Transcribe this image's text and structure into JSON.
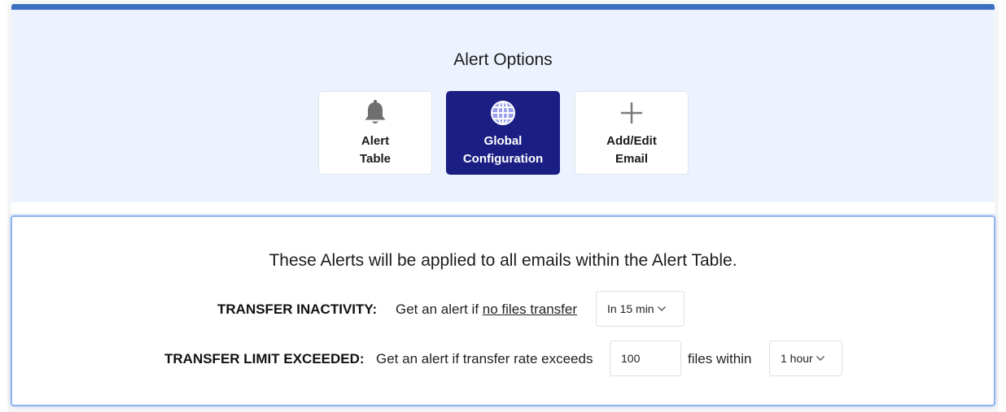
{
  "header": {
    "title": "Alert Options",
    "options": [
      {
        "line1": "Alert",
        "line2": "Table",
        "icon": "bell-icon",
        "active": false
      },
      {
        "line1": "Global",
        "line2": "Configuration",
        "icon": "globe-icon",
        "active": true
      },
      {
        "line1": "Add/Edit",
        "line2": "Email",
        "icon": "plus-icon",
        "active": false
      }
    ]
  },
  "config": {
    "intro": "These Alerts will be applied to all emails within the Alert Table.",
    "inactivity": {
      "label": "TRANSFER INACTIVITY:",
      "text_prefix": "Get an alert if ",
      "text_link": "no files transfer",
      "select_value": "In 15 min"
    },
    "limit": {
      "label": "TRANSFER LIMIT EXCEEDED:",
      "text": "Get an alert if transfer rate exceeds",
      "input_value": "100",
      "text_after": "files within",
      "select_value": "1 hour"
    }
  },
  "colors": {
    "accent_bar": "#3a6fc4",
    "header_bg": "#edf3fe",
    "active_button": "#1b1f84",
    "panel_border": "#8db3ef"
  }
}
